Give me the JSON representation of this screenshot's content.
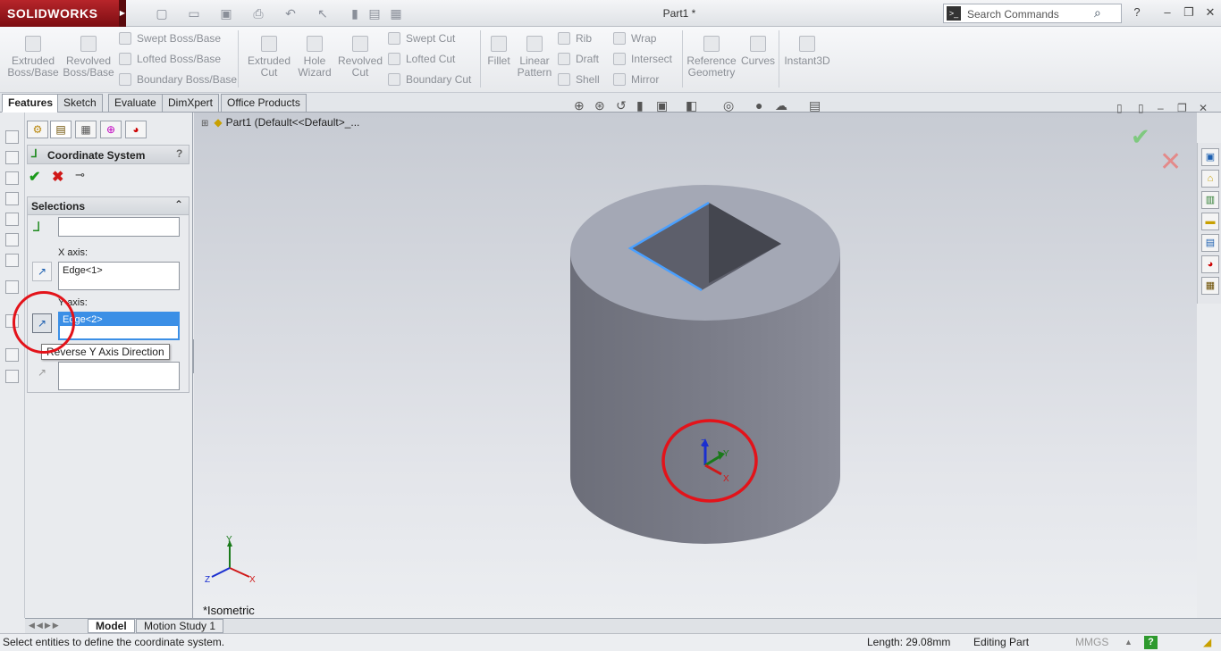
{
  "app": {
    "logo": "SOLIDWORKS",
    "doc_title": "Part1 *"
  },
  "search": {
    "placeholder": "Search Commands"
  },
  "window_buttons": {
    "help": "?",
    "minimize": "–",
    "restore": "❐",
    "close": "✕"
  },
  "ribbon": {
    "extruded_boss": [
      "Extruded",
      "Boss/Base"
    ],
    "revolved_boss": [
      "Revolved",
      "Boss/Base"
    ],
    "swept_boss": "Swept Boss/Base",
    "lofted_boss": "Lofted Boss/Base",
    "boundary_boss": "Boundary Boss/Base",
    "extruded_cut": [
      "Extruded",
      "Cut"
    ],
    "hole_wizard": [
      "Hole",
      "Wizard"
    ],
    "revolved_cut": [
      "Revolved",
      "Cut"
    ],
    "swept_cut": "Swept Cut",
    "lofted_cut": "Lofted Cut",
    "boundary_cut": "Boundary Cut",
    "fillet": "Fillet",
    "linear_pattern": [
      "Linear",
      "Pattern"
    ],
    "rib": "Rib",
    "draft": "Draft",
    "shell": "Shell",
    "wrap": "Wrap",
    "intersect": "Intersect",
    "mirror": "Mirror",
    "reference_geometry": [
      "Reference",
      "Geometry"
    ],
    "curves": "Curves",
    "instant3d": "Instant3D"
  },
  "tabs": [
    "Features",
    "Sketch",
    "Evaluate",
    "DimXpert",
    "Office Products"
  ],
  "property_manager": {
    "title": "Coordinate System",
    "help": "?",
    "selections_title": "Selections",
    "origin_value": "",
    "x_axis_label": "X axis:",
    "x_axis_value": "Edge<1>",
    "y_axis_label": "Y axis:",
    "y_axis_value": "Edge<2>",
    "z_axis_value": "",
    "tooltip": "Reverse Y Axis Direction"
  },
  "viewport": {
    "tree_root": "Part1  (Default<<Default>_...",
    "orientation": "*Isometric",
    "triad_labels": {
      "x": "X",
      "y": "Y",
      "z": "Z"
    },
    "colors": {
      "model_top": "#a4a8b5",
      "model_side": "#71737f",
      "highlight": "#4aa0ff",
      "annotation": "#e3131a"
    }
  },
  "bottom_tabs": [
    "Model",
    "Motion Study 1"
  ],
  "status": {
    "message": "Select entities to define the coordinate system.",
    "length": "Length: 29.08mm",
    "mode": "Editing Part",
    "units": "MMGS",
    "help_badge": "?"
  }
}
